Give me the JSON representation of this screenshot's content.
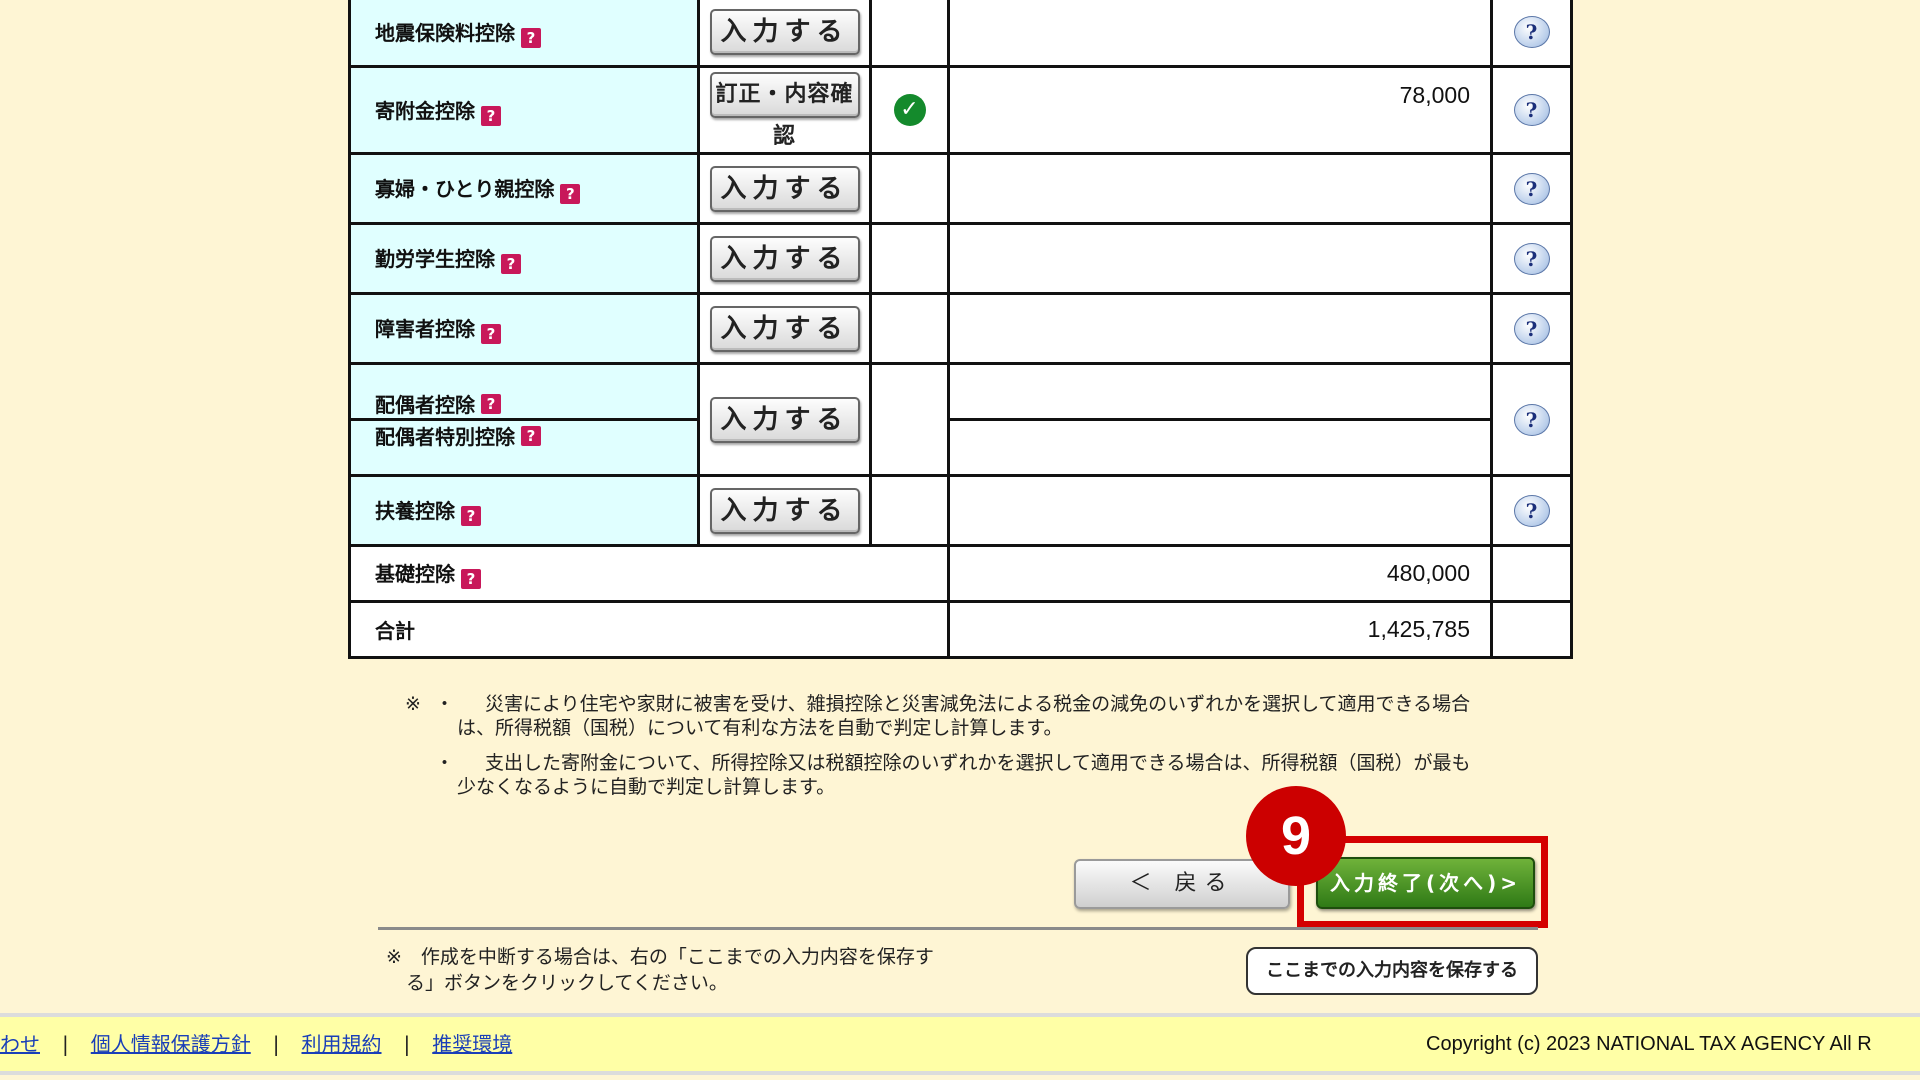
{
  "table": {
    "rows": [
      {
        "name": "地震保険料控除",
        "button": "入力する",
        "checked": false,
        "amount": ""
      },
      {
        "name": "寄附金控除",
        "button": "訂正・内容確認",
        "checked": true,
        "amount": "78,000"
      },
      {
        "name": "寡婦・ひとり親控除",
        "button": "入力する",
        "checked": false,
        "amount": ""
      },
      {
        "name": "勤労学生控除",
        "button": "入力する",
        "checked": false,
        "amount": ""
      },
      {
        "name": "障害者控除",
        "button": "入力する",
        "checked": false,
        "amount": ""
      },
      {
        "name_a": "配偶者控除",
        "name_b": "配偶者特別控除",
        "button": "入力する",
        "checked": false,
        "amount_a": "",
        "amount_b": ""
      },
      {
        "name": "扶養控除",
        "button": "入力する",
        "checked": false,
        "amount": ""
      }
    ],
    "basic_name": "基礎控除",
    "basic_amount": "480,000",
    "total_name": "合計",
    "total_amount": "1,425,785",
    "question_glyph": "?",
    "help_glyph": "?",
    "check_glyph": "✓",
    "icons": {
      "name_help": "question-icon",
      "row_help": "help-bubble-icon",
      "status": "check-icon"
    }
  },
  "notes": {
    "mark": "※",
    "bullet": "・",
    "note1_line1": "災害により住宅や家財に被害を受け、雑損控除と災害減免法による税金の減免のいずれかを選択して適用できる場合",
    "note1_line2": "は、所得税額（国税）について有利な方法を自動で判定し計算します。",
    "note2_line1": "支出した寄附金について、所得控除又は税額控除のいずれかを選択して適用できる場合は、所得税額（国税）が最も",
    "note2_line2": "少なくなるように自動で判定し計算します。"
  },
  "nav": {
    "back_label": "＜ 戻る",
    "next_label": "入力終了(次へ)>",
    "step_number": "9",
    "highlight_color": "#d40000"
  },
  "save": {
    "note_line1": "※　作成を中断する場合は、右の「ここまでの入力内容を保存す",
    "note_line2": "る」ボタンをクリックしてください。",
    "button_label": "ここまでの入力内容を保存する"
  },
  "footer": {
    "links": [
      "わせ",
      "個人情報保護方針",
      "利用規約",
      "推奨環境"
    ],
    "separator": "|",
    "copyright": "Copyright (c) 2023 NATIONAL TAX AGENCY All R"
  }
}
